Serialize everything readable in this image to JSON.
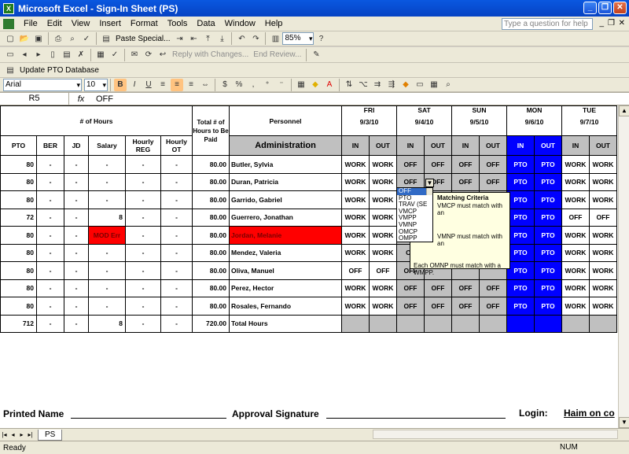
{
  "window": {
    "title": "Microsoft Excel - Sign-In Sheet (PS)"
  },
  "menu": {
    "items": [
      "File",
      "Edit",
      "View",
      "Insert",
      "Format",
      "Tools",
      "Data",
      "Window",
      "Help"
    ],
    "help_placeholder": "Type a question for help"
  },
  "toolbar1": {
    "paste_special": "Paste Special...",
    "zoom": "85%"
  },
  "toolbar2": {
    "reply": "Reply with Changes...",
    "end_review": "End Review..."
  },
  "toolbar3": {
    "update": "Update PTO Database"
  },
  "formatting": {
    "font": "Arial",
    "size": "10"
  },
  "formula": {
    "cell": "R5",
    "fx": "fx",
    "value": "OFF"
  },
  "sheet": {
    "hours_header": "# of Hours",
    "total_header": "Total # of Hours to Be Paid",
    "personnel": "Personnel",
    "administration": "Administration",
    "col_heads": [
      "PTO",
      "BER",
      "JD",
      "Salary",
      "Hourly REG",
      "Hourly OT"
    ],
    "days": [
      {
        "name": "FRI",
        "date": "9/3/10"
      },
      {
        "name": "SAT",
        "date": "9/4/10"
      },
      {
        "name": "SUN",
        "date": "9/5/10"
      },
      {
        "name": "MON",
        "date": "9/6/10"
      },
      {
        "name": "TUE",
        "date": "9/7/10"
      }
    ],
    "in_label": "IN",
    "out_label": "OUT",
    "rows": [
      {
        "pto": "80",
        "ber": "-",
        "jd": "-",
        "salary": "-",
        "reg": "-",
        "ot": "-",
        "total": "80.00",
        "name": "Butler, Sylvia",
        "shifts": [
          "WORK",
          "WORK",
          "OFF",
          "OFF",
          "OFF",
          "OFF",
          "PTO",
          "PTO",
          "WORK",
          "WORK"
        ]
      },
      {
        "pto": "80",
        "ber": "-",
        "jd": "-",
        "salary": "-",
        "reg": "-",
        "ot": "-",
        "total": "80.00",
        "name": "Duran, Patricia",
        "shifts": [
          "WORK",
          "WORK",
          "OFF",
          "OFF",
          "OFF",
          "OFF",
          "PTO",
          "PTO",
          "WORK",
          "WORK"
        ]
      },
      {
        "pto": "80",
        "ber": "-",
        "jd": "-",
        "salary": "-",
        "reg": "-",
        "ot": "-",
        "total": "80.00",
        "name": "Garrido, Gabriel",
        "shifts": [
          "WORK",
          "WORK",
          "",
          "",
          "",
          "",
          "PTO",
          "PTO",
          "WORK",
          "WORK"
        ]
      },
      {
        "pto": "72",
        "ber": "-",
        "jd": "-",
        "salary": "8",
        "reg": "-",
        "ot": "-",
        "total": "80.00",
        "name": "Guerrero, Jonathan",
        "shifts": [
          "WORK",
          "WORK",
          "",
          "",
          "",
          "",
          "PTO",
          "PTO",
          "OFF",
          "OFF"
        ]
      },
      {
        "pto": "80",
        "ber": "-",
        "jd": "-",
        "salary": "MOD Err",
        "reg": "-",
        "ot": "-",
        "total": "80.00",
        "name": "Jordan, Melanie",
        "shifts": [
          "WORK",
          "WORK",
          "",
          "",
          "",
          "",
          "PTO",
          "PTO",
          "WORK",
          "WORK"
        ]
      },
      {
        "pto": "80",
        "ber": "-",
        "jd": "-",
        "salary": "-",
        "reg": "-",
        "ot": "-",
        "total": "80.00",
        "name": "Mendez, Valeria",
        "shifts": [
          "WORK",
          "WORK",
          "OF",
          "",
          "",
          "",
          "PTO",
          "PTO",
          "WORK",
          "WORK"
        ]
      },
      {
        "pto": "80",
        "ber": "-",
        "jd": "-",
        "salary": "-",
        "reg": "-",
        "ot": "-",
        "total": "80.00",
        "name": "Oliva, Manuel",
        "shifts": [
          "OFF",
          "OFF",
          "OFF",
          "",
          "",
          "",
          "PTO",
          "PTO",
          "WORK",
          "WORK"
        ]
      },
      {
        "pto": "80",
        "ber": "-",
        "jd": "-",
        "salary": "-",
        "reg": "-",
        "ot": "-",
        "total": "80.00",
        "name": "Perez, Hector",
        "shifts": [
          "WORK",
          "WORK",
          "OFF",
          "OFF",
          "OFF",
          "OFF",
          "PTO",
          "PTO",
          "WORK",
          "WORK"
        ]
      },
      {
        "pto": "80",
        "ber": "-",
        "jd": "-",
        "salary": "-",
        "reg": "-",
        "ot": "-",
        "total": "80.00",
        "name": "Rosales, Fernando",
        "shifts": [
          "WORK",
          "WORK",
          "OFF",
          "OFF",
          "OFF",
          "OFF",
          "PTO",
          "PTO",
          "WORK",
          "WORK"
        ]
      }
    ],
    "totals": {
      "pto": "712",
      "ber": "-",
      "jd": "-",
      "salary": "8",
      "reg": "-",
      "ot": "-",
      "total": "720.00",
      "label": "Total Hours"
    },
    "printed_name": "Printed Name",
    "approval": "Approval Signature",
    "login": "Login:",
    "haim": "Haim on co"
  },
  "dropdown": {
    "options": [
      "OFF",
      "PTO",
      "TRAV (SE",
      "VMCP",
      "VMPP",
      "VMNP",
      "OMCP",
      "OMPP"
    ]
  },
  "tooltip": {
    "title": "Matching Criteria",
    "lines": [
      "VMCP must match with an",
      "VMNP must match with an",
      "Each OMNP must match with a WMPP."
    ]
  },
  "tabs": {
    "sheet": "PS"
  },
  "status": {
    "left": "Ready",
    "num": "NUM"
  }
}
